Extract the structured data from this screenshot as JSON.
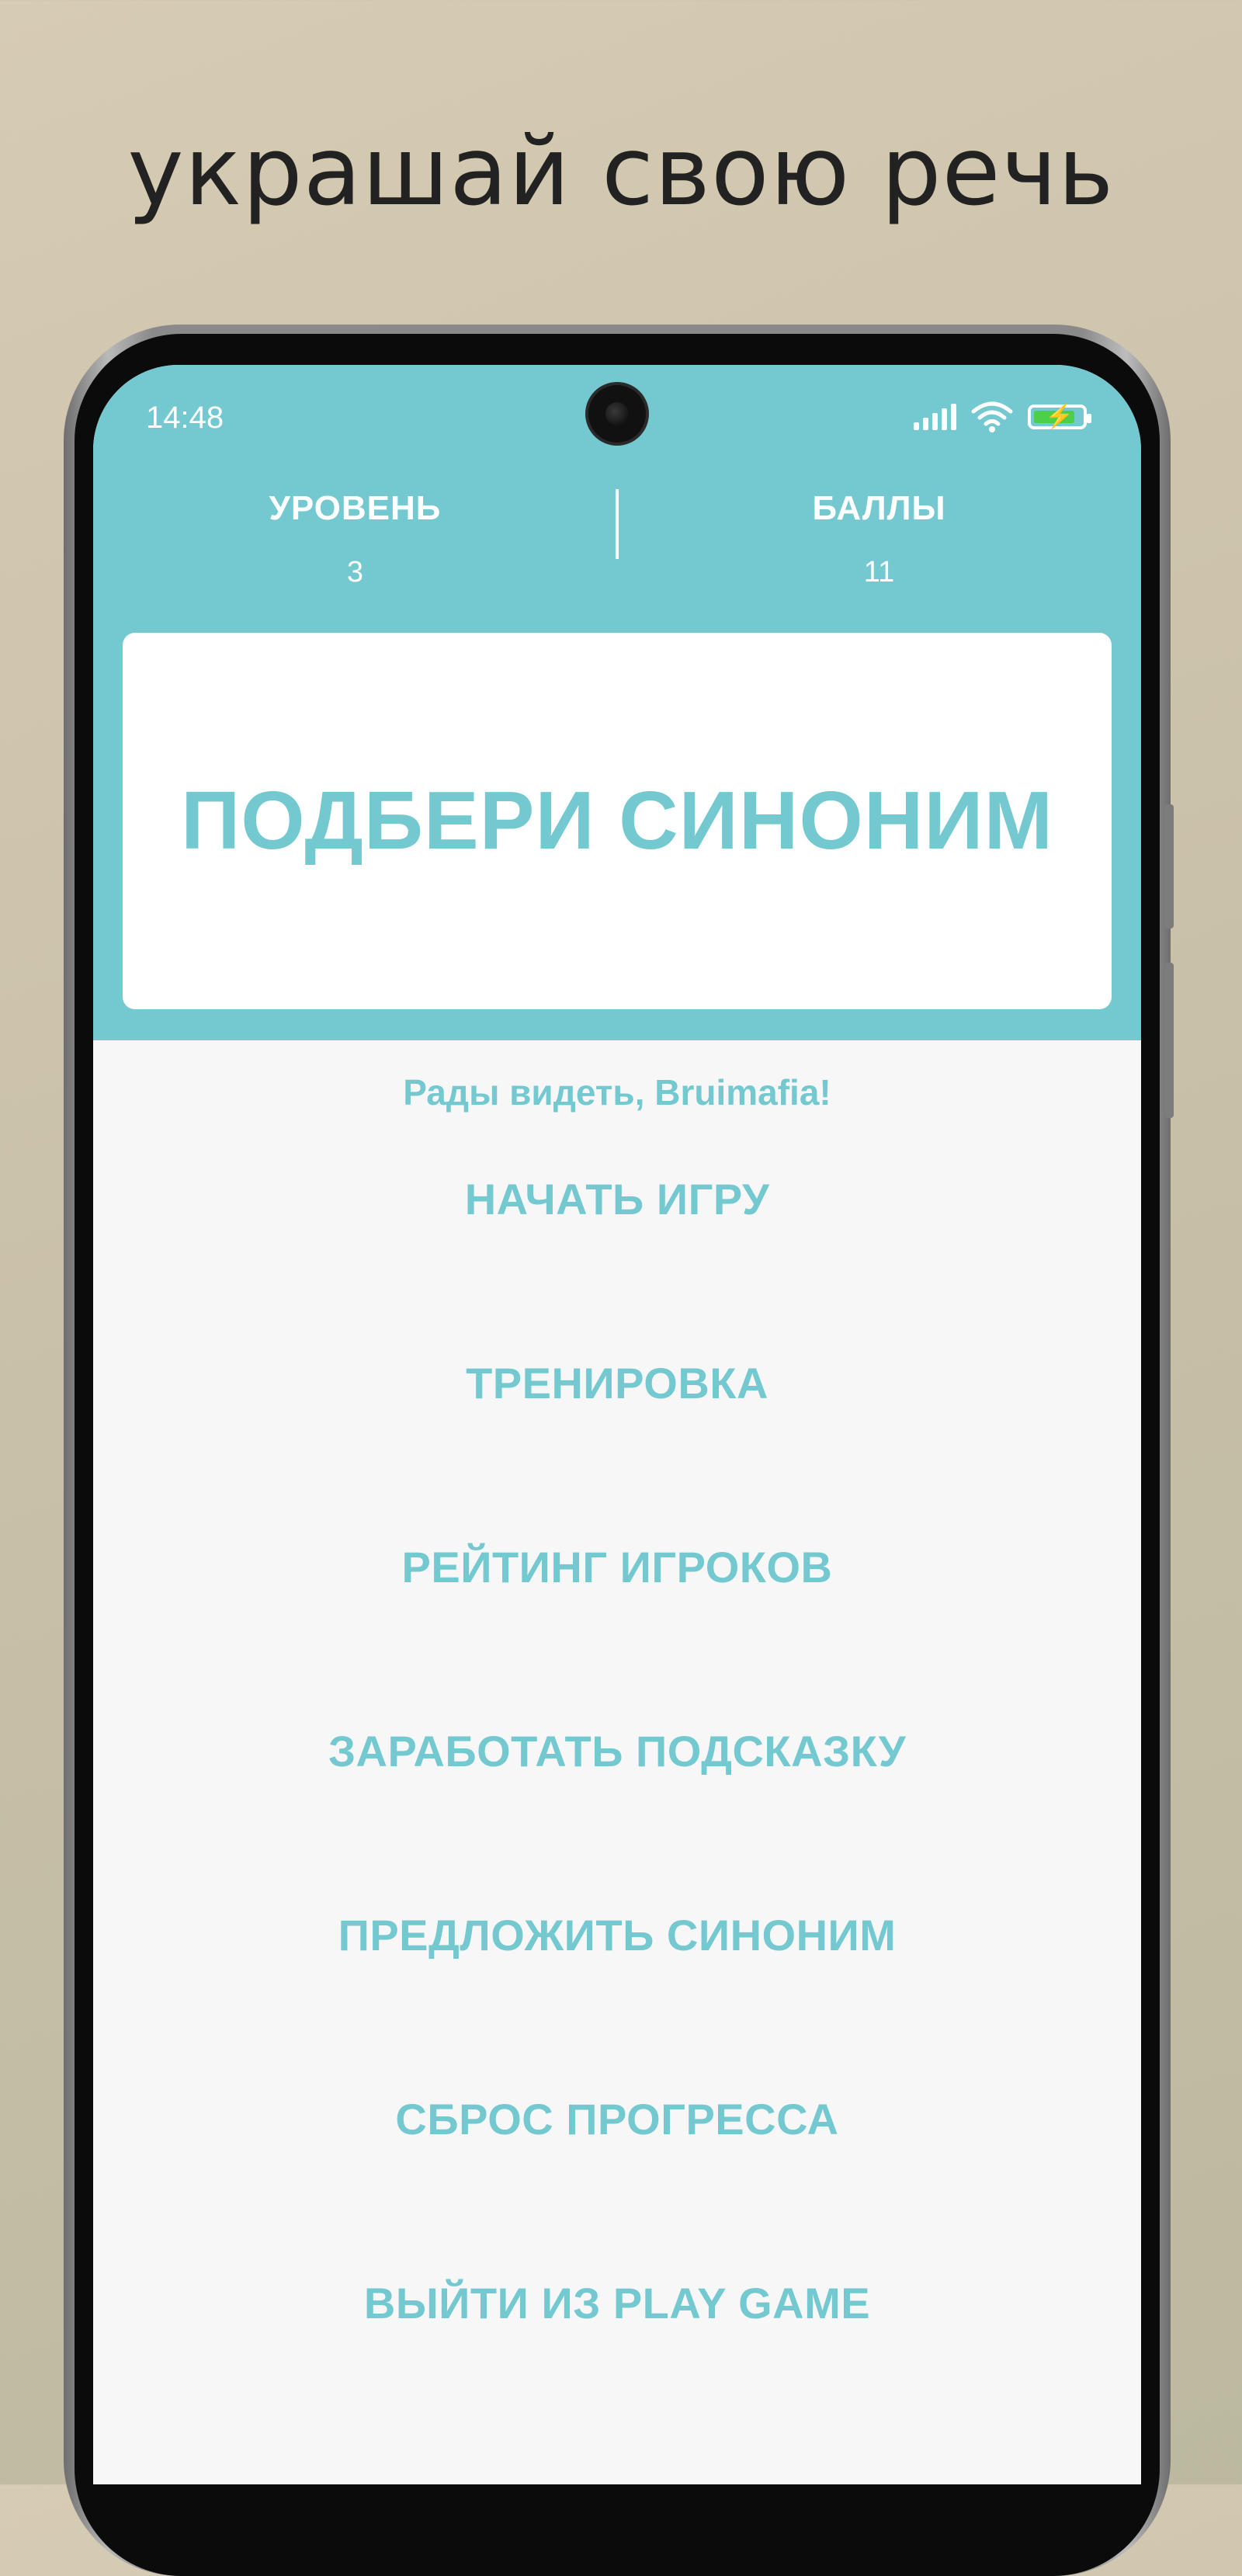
{
  "promo": {
    "headline": "украшай свою речь"
  },
  "status_bar": {
    "time": "14:48",
    "icons": [
      "signal-icon",
      "wifi-icon",
      "battery-charging-icon"
    ],
    "battery_color": "#4cd04c"
  },
  "stats": {
    "level_label": "УРОВЕНЬ",
    "level_value": "3",
    "score_label": "БАЛЛЫ",
    "score_value": "11"
  },
  "app": {
    "title": "ПОДБЕРИ СИНОНИМ",
    "welcome": "Рады видеть, Bruimafia!",
    "accent_color": "#73c9cf"
  },
  "menu": {
    "items": [
      {
        "label": "НАЧАТЬ ИГРУ"
      },
      {
        "label": "ТРЕНИРОВКА"
      },
      {
        "label": "РЕЙТИНГ ИГРОКОВ"
      },
      {
        "label": "ЗАРАБОТАТЬ ПОДСКАЗКУ"
      },
      {
        "label": "ПРЕДЛОЖИТЬ СИНОНИМ"
      },
      {
        "label": "СБРОС ПРОГРЕССА"
      },
      {
        "label": "ВЫЙТИ ИЗ PLAY GAME"
      }
    ]
  }
}
